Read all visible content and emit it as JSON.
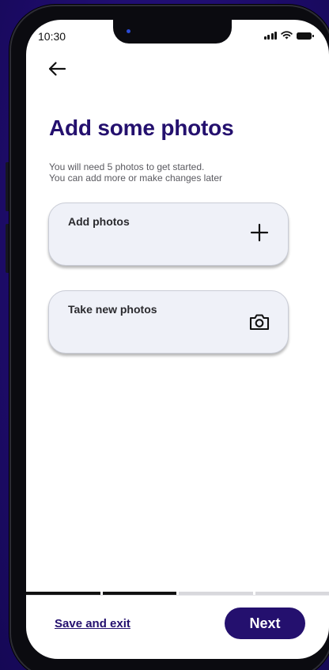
{
  "status_bar": {
    "time": "10:30",
    "icons": [
      "signal-icon",
      "wifi-icon",
      "battery-icon"
    ]
  },
  "header": {
    "back_icon": "arrow-left-icon"
  },
  "main": {
    "title": "Add some photos",
    "subtitle_line1": "You will need 5 photos to get started.",
    "subtitle_line2": "You can add more or make changes later",
    "options": [
      {
        "label": "Add photos",
        "icon": "plus-icon"
      },
      {
        "label": "Take new photos",
        "icon": "camera-icon"
      }
    ]
  },
  "progress": {
    "total_steps": 4,
    "completed_steps": 2
  },
  "footer": {
    "save_exit_label": "Save and exit",
    "next_label": "Next"
  },
  "colors": {
    "brand": "#24106e",
    "background_outer": "#24107a",
    "card_bg": "#eff1f8"
  }
}
